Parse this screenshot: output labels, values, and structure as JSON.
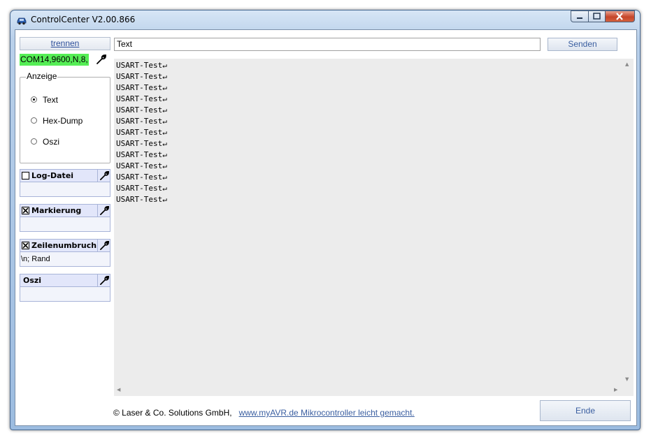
{
  "window": {
    "title": "ControlCenter V2.00.866",
    "app_icon": "car-icon",
    "controls": [
      "minimize-icon",
      "maximize-icon",
      "close-icon"
    ]
  },
  "connection": {
    "disconnect_label": "trennen",
    "port_status": "COM14,9600,N,8,",
    "port_status_color": "#55ee55",
    "settings_icon": "wrench-icon"
  },
  "display": {
    "group_label": "Anzeige",
    "options": [
      {
        "label": "Text",
        "selected": true
      },
      {
        "label": "Hex-Dump",
        "selected": false
      },
      {
        "label": "Oszi",
        "selected": false
      }
    ]
  },
  "panels": [
    {
      "title": "Log-Datei",
      "has_checkbox": true,
      "checked": false,
      "body": ""
    },
    {
      "title": "Markierung",
      "has_checkbox": true,
      "checked": true,
      "body": ""
    },
    {
      "title": "Zeilenumbruch",
      "has_checkbox": true,
      "checked": true,
      "body": "\\n; Rand"
    },
    {
      "title": "Oszi",
      "has_checkbox": false,
      "checked": false,
      "body": ""
    }
  ],
  "send": {
    "input_value": "Text",
    "button_label": "Senden"
  },
  "output": {
    "lines": [
      "USART-Test↵",
      "USART-Test↵",
      "USART-Test↵",
      "USART-Test↵",
      "USART-Test↵",
      "USART-Test↵",
      "USART-Test↵",
      "USART-Test↵",
      "USART-Test↵",
      "USART-Test↵",
      "USART-Test↵",
      "USART-Test↵",
      "USART-Test↵"
    ]
  },
  "footer": {
    "copyright": "© Laser & Co. Solutions GmbH,",
    "link": "www.myAVR.de Mikrocontroller leicht gemacht.",
    "exit_label": "Ende"
  },
  "colors": {
    "accent": "#3a5ea0",
    "panel_header": "#e2e6fa",
    "output_bg": "#ececec"
  }
}
